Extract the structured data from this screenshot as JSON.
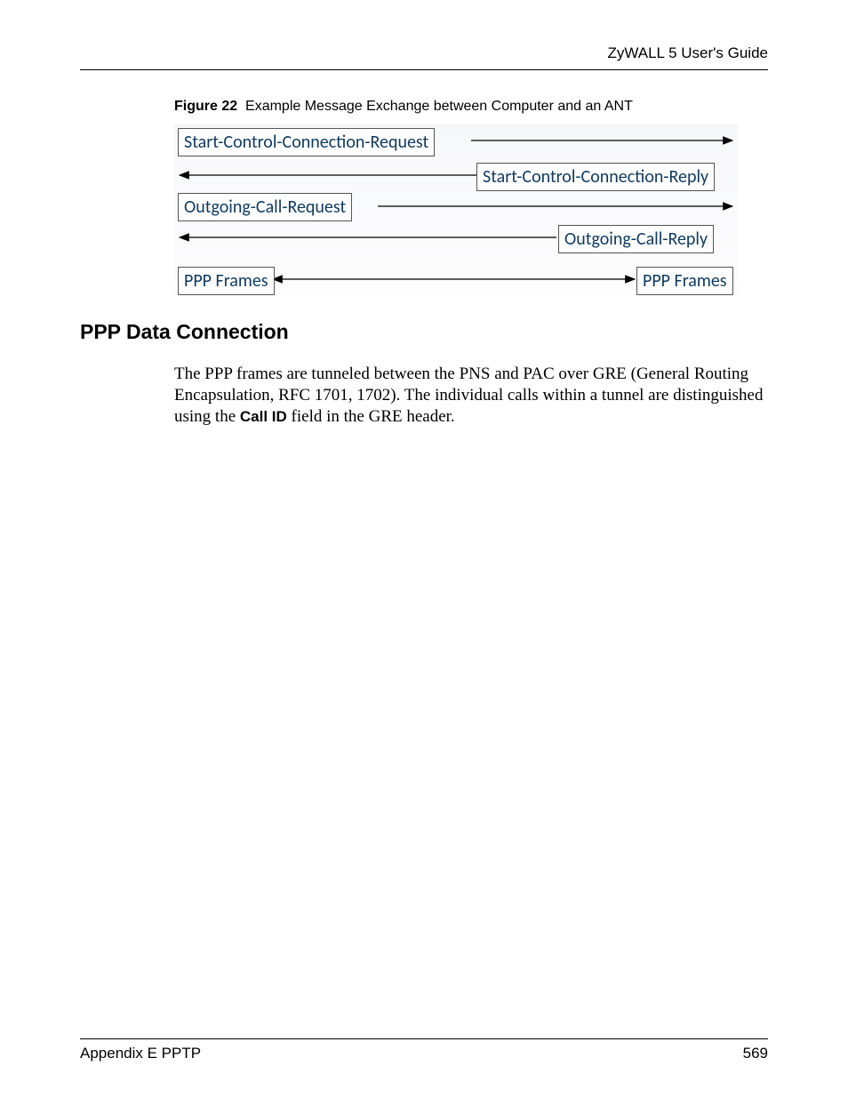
{
  "header": {
    "guide_title": "ZyWALL 5 User's Guide"
  },
  "figure": {
    "label": "Figure 22",
    "caption": "Example Message Exchange between Computer and an ANT",
    "boxes": {
      "sccr_request": "Start-Control-Connection-Request",
      "sccr_reply": "Start-Control-Connection-Reply",
      "ocr_request": "Outgoing-Call-Request",
      "ocr_reply": "Outgoing-Call-Reply",
      "ppp_left": "PPP Frames",
      "ppp_right": "PPP Frames"
    }
  },
  "section": {
    "heading": "PPP Data Connection",
    "paragraph_pre": "The PPP frames are tunneled between the PNS and PAC over GRE (General Routing Encapsulation, RFC 1701, 1702). The individual calls within a tunnel are distinguished using the ",
    "call_id": "Call ID",
    "paragraph_post": " field in the GRE header."
  },
  "footer": {
    "appendix": "Appendix E PPTP",
    "page_number": "569"
  }
}
